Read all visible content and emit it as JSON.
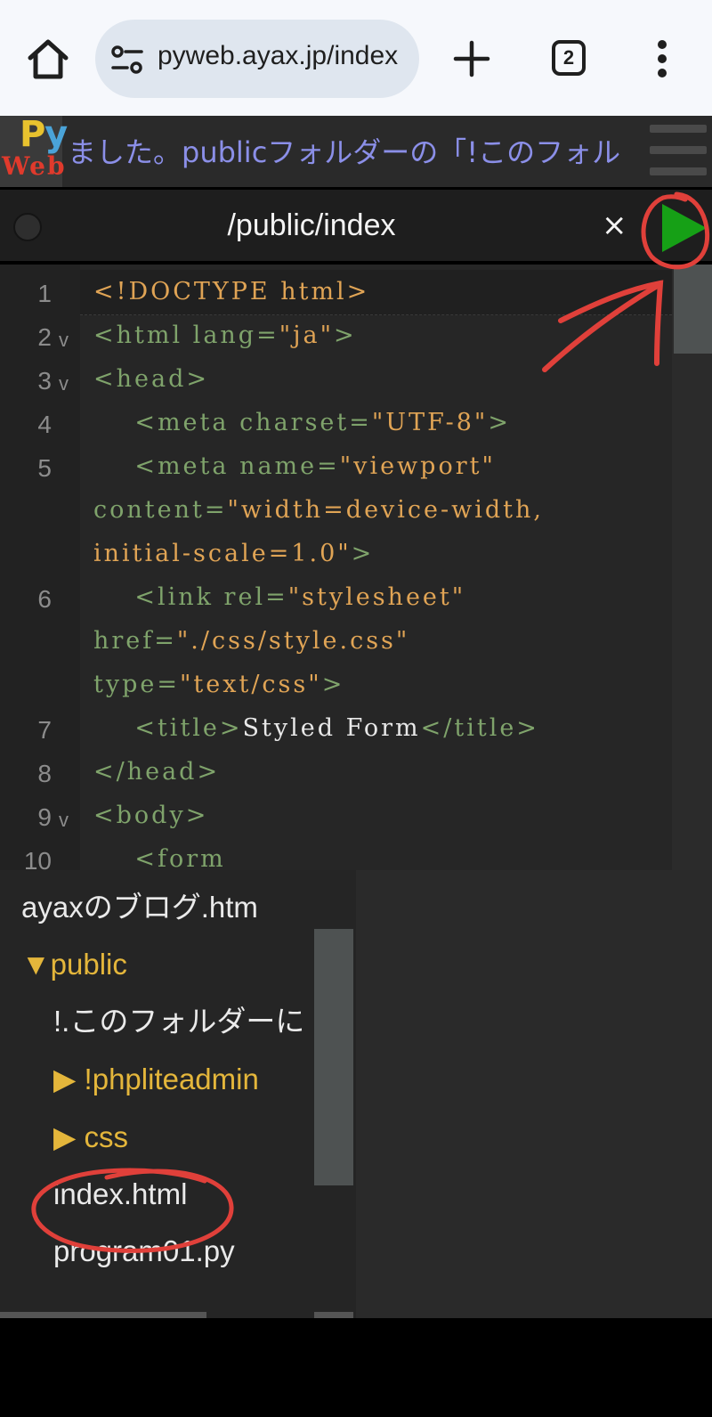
{
  "browser": {
    "url": "pyweb.ayax.jp/index",
    "tab_count": "2"
  },
  "app": {
    "logo_top": "Py",
    "logo_bottom": "Web",
    "marquee": "ました。publicフォルダーの「!このフォル"
  },
  "editor": {
    "tab_title": "/public/index",
    "close_symbol": "×",
    "lines": [
      {
        "num": "1",
        "fold": false
      },
      {
        "num": "2",
        "fold": true
      },
      {
        "num": "3",
        "fold": true
      },
      {
        "num": "4",
        "fold": false
      },
      {
        "num": "5",
        "fold": false
      },
      {
        "num": "6",
        "fold": false
      },
      {
        "num": "7",
        "fold": false
      },
      {
        "num": "8",
        "fold": false
      },
      {
        "num": "9",
        "fold": true
      },
      {
        "num": "10",
        "fold": true
      }
    ],
    "code": {
      "l1": "<!DOCTYPE html>",
      "l2_open": "<html lang=",
      "l2_val": "\"ja\"",
      "l2_close": ">",
      "l3": "<head>",
      "l4_open": "    <meta charset=",
      "l4_val": "\"UTF-8\"",
      "l4_close": ">",
      "l5_open": "    <meta name=",
      "l5_val": "\"viewport\"",
      "l5b_attr": "content=",
      "l5b_val": "\"width=device-width,",
      "l5c_val": "initial-scale=1.0\"",
      "l5c_close": ">",
      "l6_open": "    <link rel=",
      "l6_val": "\"stylesheet\"",
      "l6b_attr": "href=",
      "l6b_val": "\"./css/style.css\"",
      "l6c_attr": "type=",
      "l6c_val": "\"text/css\"",
      "l6c_close": ">",
      "l7_open": "    <title>",
      "l7_text": "Styled Form",
      "l7_close": "</title>",
      "l8": "</head>",
      "l9": "<body>",
      "l10": "    <form"
    }
  },
  "filetree": {
    "items": [
      {
        "label": "ayaxのブログ.htm",
        "type": "file"
      },
      {
        "label": "▼public",
        "type": "folder-open"
      },
      {
        "label": "!.このフォルダーに",
        "type": "file"
      },
      {
        "label": "▶ !phpliteadmin",
        "type": "folder"
      },
      {
        "label": "▶ css",
        "type": "folder"
      },
      {
        "label": "index.html",
        "type": "file"
      },
      {
        "label": "program01.py",
        "type": "file"
      }
    ]
  },
  "colors": {
    "run_button": "#16a016",
    "annotation": "#e0403a",
    "folder": "#e4b63b",
    "marquee": "#8b8fe8"
  },
  "icons": [
    "home-icon",
    "tune-icon",
    "plus-icon",
    "tab-switcher-icon",
    "more-vert-icon",
    "hamburger-icon",
    "play-icon",
    "close-icon"
  ]
}
